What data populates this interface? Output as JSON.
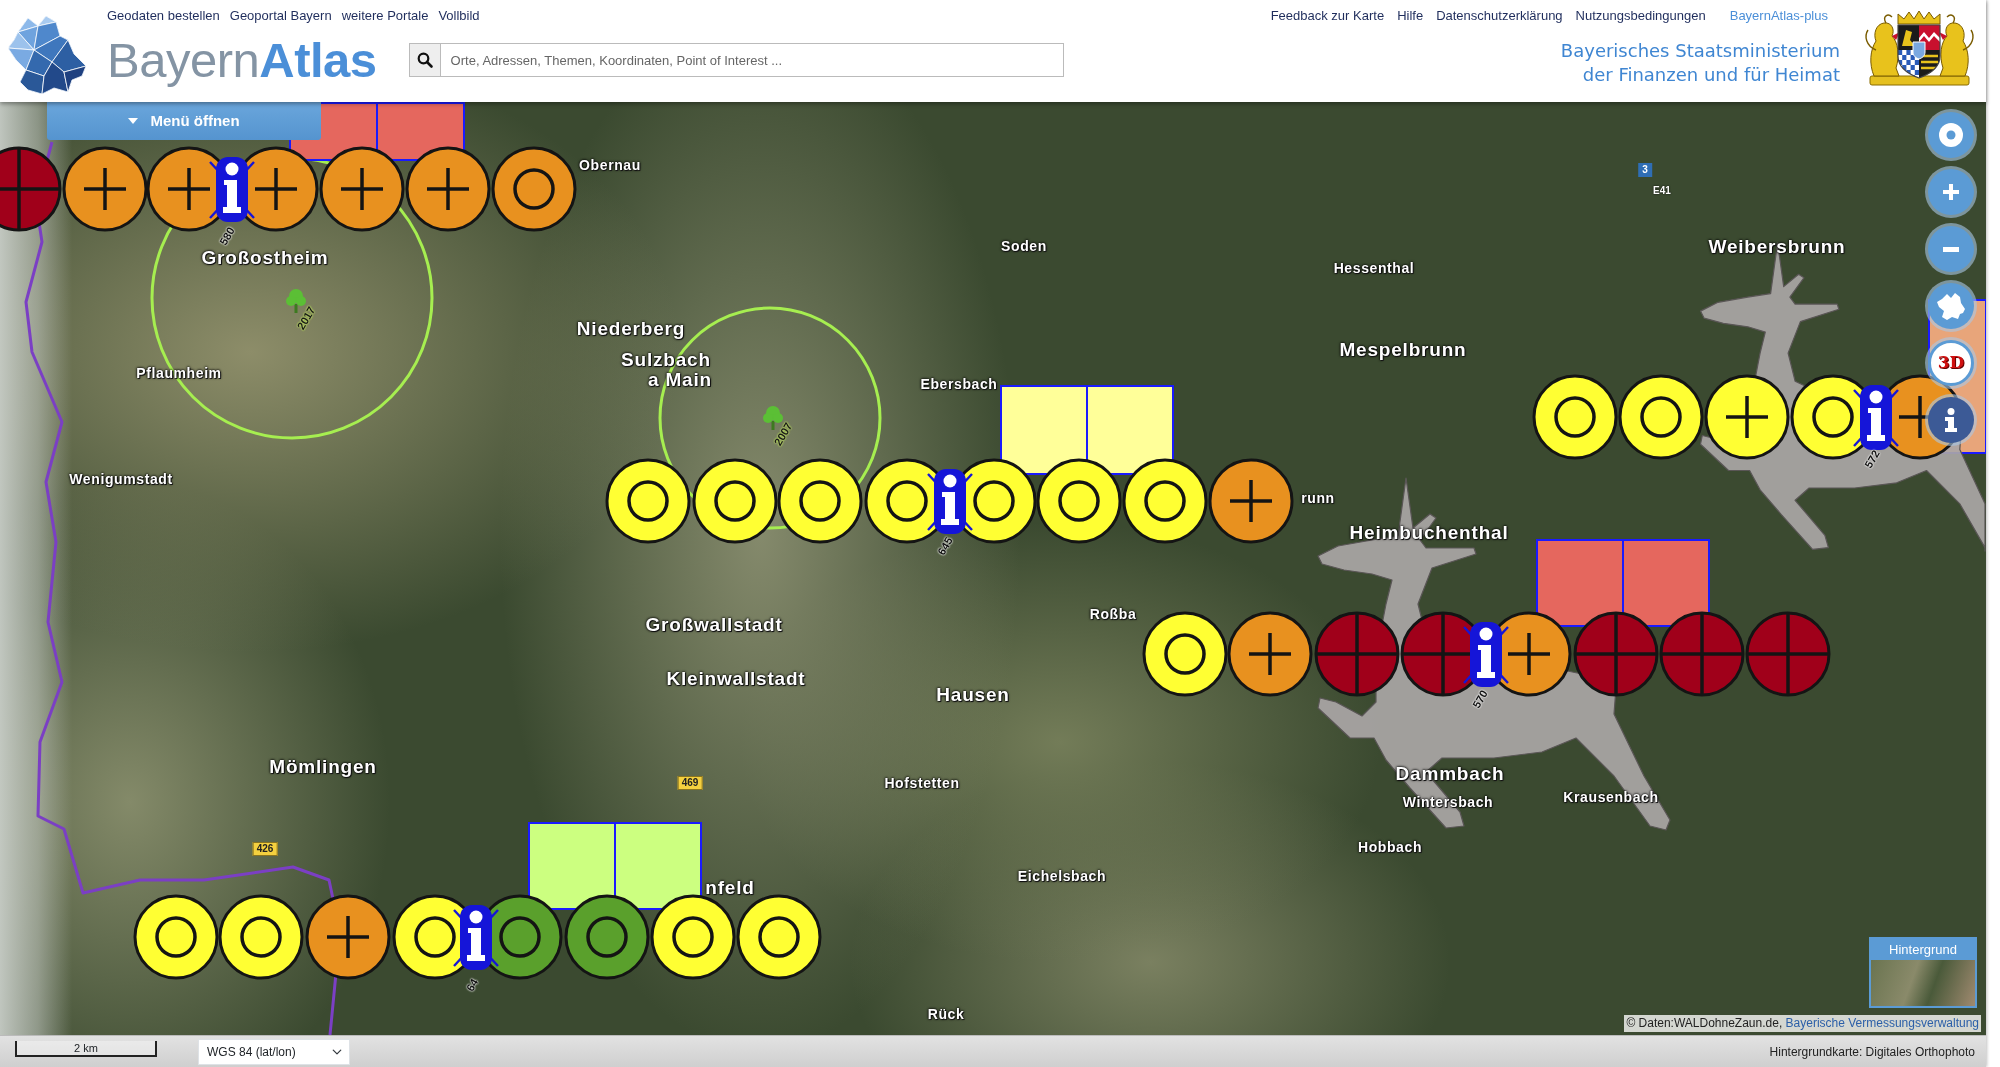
{
  "header": {
    "top_links": [
      "Geodaten bestellen",
      "Geoportal Bayern",
      "weitere Portale",
      "Vollbild"
    ],
    "app_name": "Bayern**Atlas**",
    "search": {
      "placeholder": "Orte, Adressen, Themen, Koordinaten, Point of Interest ..."
    },
    "service_links": [
      {
        "label": "Feedback zur Karte",
        "kind": "plain"
      },
      {
        "label": "Hilfe",
        "kind": "plain"
      },
      {
        "label": "Datenschutzerklärung",
        "kind": "plain"
      },
      {
        "label": "Nutzungsbedingungen",
        "kind": "plain"
      },
      {
        "label": "BayernAtlas-plus",
        "kind": "highlight"
      }
    ],
    "ministry": [
      "Bayerisches Staatsministerium",
      "der Finanzen und für Heimat"
    ]
  },
  "map": {
    "menu_button": {
      "label": "Menü öffnen"
    },
    "place_labels": [
      {
        "text": "Obernau",
        "kind": "village"
      },
      {
        "text": "Soden",
        "kind": "village"
      },
      {
        "text": "Weibersbrunn",
        "kind": "town"
      },
      {
        "text": "Großostheim",
        "kind": "town"
      },
      {
        "text": "Hessenthal",
        "kind": "village"
      },
      {
        "text": "Niederberg",
        "kind": "town"
      },
      {
        "text": "Mespelbrunn",
        "kind": "town"
      },
      {
        "text": "Sulzbach",
        "kind": "town"
      },
      {
        "text": "Pflaumheim",
        "kind": "village"
      },
      {
        "text": "a Main",
        "kind": "town"
      },
      {
        "text": "Ebersbach",
        "kind": "village"
      },
      {
        "text": "Wenigumstadt",
        "kind": "village"
      },
      {
        "text": "runn",
        "kind": "village"
      },
      {
        "text": "Heimbuchenthal",
        "kind": "town"
      },
      {
        "text": "Roßba",
        "kind": "village"
      },
      {
        "text": "Großwallstadt",
        "kind": "town"
      },
      {
        "text": "Kleinwallstadt",
        "kind": "town"
      },
      {
        "text": "Hausen",
        "kind": "town"
      },
      {
        "text": "Mömlingen",
        "kind": "town"
      },
      {
        "text": "Dammbach",
        "kind": "town"
      },
      {
        "text": "Hofstetten",
        "kind": "village"
      },
      {
        "text": "Krausenbach",
        "kind": "village"
      },
      {
        "text": "Wintersbach",
        "kind": "village"
      },
      {
        "text": "Hobbach",
        "kind": "village"
      },
      {
        "text": "Eichelsbach",
        "kind": "village"
      },
      {
        "text": "nfeld",
        "kind": "town"
      },
      {
        "text": "Rück",
        "kind": "village"
      }
    ],
    "road_labels": [
      {
        "text": "3",
        "kind": "motorway"
      },
      {
        "text": "E41",
        "kind": "european_route"
      },
      {
        "text": "469",
        "kind": "federal_road"
      },
      {
        "text": "426",
        "kind": "federal_road"
      }
    ],
    "radius_rings": [
      {
        "year": "2017"
      },
      {
        "year": "2007"
      }
    ],
    "areas": [
      {
        "color": "#e5675e"
      },
      {
        "color": "#e5675e"
      },
      {
        "color": "#e8a57a"
      },
      {
        "color": "#ffff99"
      },
      {
        "color": "#ffff99"
      },
      {
        "color": "#e5675e"
      },
      {
        "color": "#e5675e"
      },
      {
        "color": "#ccff80"
      },
      {
        "color": "#ccff80"
      }
    ],
    "marker_rows": [
      {
        "info_label": "580",
        "symbols": [
          {
            "kind": "cross",
            "color": "#a0001a"
          },
          {
            "kind": "plus",
            "color": "#e8911f"
          },
          {
            "kind": "plus",
            "color": "#e8911f"
          },
          {
            "kind": "plus",
            "color": "#e8911f"
          },
          {
            "kind": "plus",
            "color": "#e8911f"
          },
          {
            "kind": "plus",
            "color": "#e8911f"
          },
          {
            "kind": "ring",
            "color": "#e8911f"
          }
        ]
      },
      {
        "info_label": "572",
        "symbols": [
          {
            "kind": "ring",
            "color": "#ffff33"
          },
          {
            "kind": "ring",
            "color": "#ffff33"
          },
          {
            "kind": "plus",
            "color": "#ffff33"
          },
          {
            "kind": "ring",
            "color": "#ffff33"
          },
          {
            "kind": "plus",
            "color": "#e8911f"
          }
        ]
      },
      {
        "info_label": "645",
        "symbols": [
          {
            "kind": "ring",
            "color": "#ffff33"
          },
          {
            "kind": "ring",
            "color": "#ffff33"
          },
          {
            "kind": "ring",
            "color": "#ffff33"
          },
          {
            "kind": "ring",
            "color": "#ffff33"
          },
          {
            "kind": "ring",
            "color": "#ffff33"
          },
          {
            "kind": "ring",
            "color": "#ffff33"
          },
          {
            "kind": "ring",
            "color": "#ffff33"
          },
          {
            "kind": "plus",
            "color": "#e8911f"
          }
        ]
      },
      {
        "info_label": "570",
        "symbols": [
          {
            "kind": "ring",
            "color": "#ffff33"
          },
          {
            "kind": "plus",
            "color": "#e8911f"
          },
          {
            "kind": "cross",
            "color": "#a0001a"
          },
          {
            "kind": "cross",
            "color": "#a0001a"
          },
          {
            "kind": "plus",
            "color": "#e8911f"
          },
          {
            "kind": "cross",
            "color": "#a0001a"
          },
          {
            "kind": "cross",
            "color": "#a0001a"
          },
          {
            "kind": "cross",
            "color": "#a0001a"
          }
        ]
      },
      {
        "info_label": "64",
        "symbols": [
          {
            "kind": "ring",
            "color": "#ffff33"
          },
          {
            "kind": "ring",
            "color": "#ffff33"
          },
          {
            "kind": "plus",
            "color": "#e8911f"
          },
          {
            "kind": "ring",
            "color": "#ffff33"
          },
          {
            "kind": "ring",
            "color": "#5aa02c"
          },
          {
            "kind": "ring",
            "color": "#5aa02c"
          },
          {
            "kind": "ring",
            "color": "#ffff33"
          },
          {
            "kind": "ring",
            "color": "#ffff33"
          }
        ]
      }
    ],
    "controls": [
      {
        "kind": "locate"
      },
      {
        "kind": "zoomin"
      },
      {
        "kind": "zoomout"
      },
      {
        "kind": "home"
      },
      {
        "kind": "perspective",
        "label": "3D"
      },
      {
        "kind": "info"
      }
    ],
    "background_switcher": {
      "label": "Hintergrund"
    },
    "attribution": {
      "text": "© Daten:WALDohneZaun.de,",
      "link": "Bayerische Vermessungsverwaltung"
    }
  },
  "status_bar": {
    "scale": "2 km",
    "projection": "WGS 84 (lat/lon)",
    "background_map": "Hintergrundkarte: Digitales Orthophoto"
  }
}
